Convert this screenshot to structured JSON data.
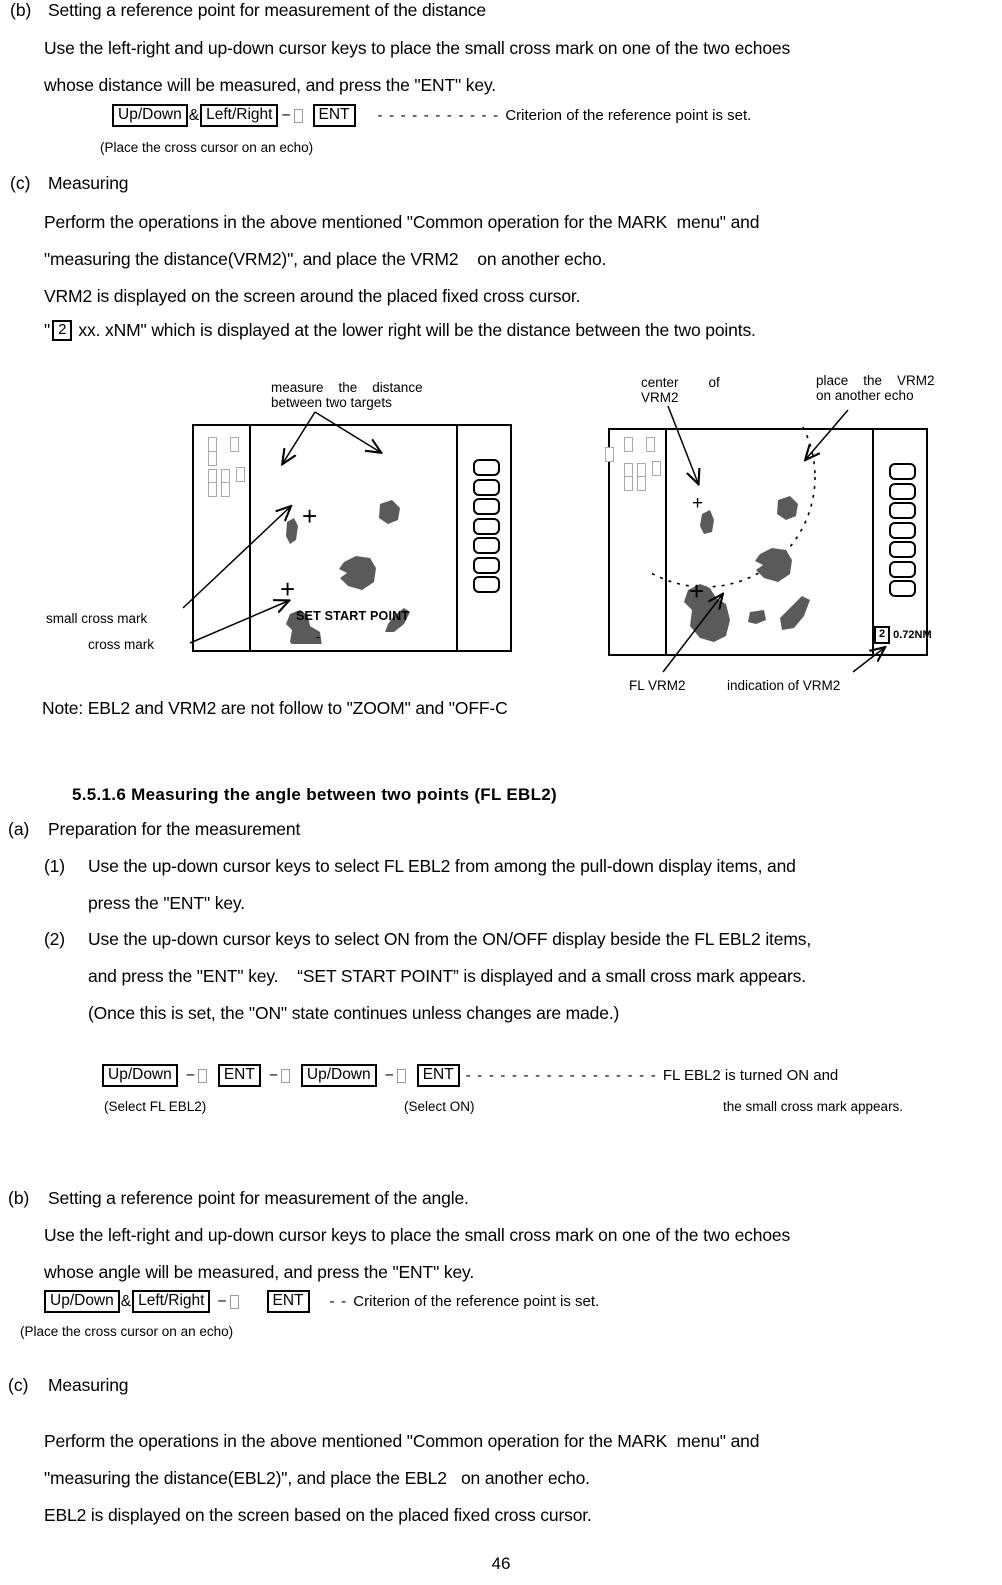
{
  "page": {
    "number": "46"
  },
  "section_b_distance": {
    "marker": "(b)",
    "title": "Setting a reference point for measurement of the distance",
    "line1": "Use the left-right and up-down cursor keys to place the small cross mark on one of the two echoes",
    "line2": "whose distance will be measured, and press the \"ENT\" key.",
    "keys": {
      "key1": "Up/Down",
      "amp": "&",
      "key2": "Left/Right",
      "minus": "−",
      "key3": "ENT",
      "dashes": "- - - - - - - - - - -",
      "result": "Criterion of the reference point is set."
    },
    "subnote": "(Place the cross cursor on an echo)"
  },
  "section_c_measuring": {
    "marker": "(c)",
    "title": "Measuring",
    "line1": "Perform the operations in the above mentioned \"Common operation for the MARK  menu\" and",
    "line2": "\"measuring the distance(VRM2)\", and place the VRM2    on another echo.",
    "line3": "VRM2 is displayed on the screen around the placed fixed cross cursor.",
    "line4_prefix": "\"",
    "line4_box": "2",
    "line4_suffix": "xx. xNM\" which is displayed at the lower right will be the distance between the two points."
  },
  "figure_left": {
    "callout_top": "measure    the    distance\nbetween two targets",
    "label_small_cross": "small cross mark",
    "label_cross": "cross mark",
    "screen_text": "SET START POINT",
    "softkey_count": 7
  },
  "figure_right": {
    "callout_center": "center        of\nVRM2",
    "callout_place": "place    the    VRM2\non another echo",
    "label_fl_vrm2": "FL VRM2",
    "label_indication": "indication of VRM2",
    "vrm_number": "2",
    "vrm_value": "0.72NM",
    "softkey_count": 7
  },
  "note": "Note: EBL2 and VRM2 are not follow to \"ZOOM\" and \"OFF-C",
  "heading_5516": "5.5.1.6 Measuring the angle between two points (FL EBL2)",
  "section_a_prep": {
    "marker": "(a)",
    "title": "Preparation for the measurement",
    "item1_marker": "(1)",
    "item1_line1": "Use the up-down cursor keys to select FL EBL2 from among the pull-down display items, and",
    "item1_line2": "press the \"ENT\" key.",
    "item2_marker": "(2)",
    "item2_line1": "Use the up-down cursor keys to select ON from the ON/OFF display beside the FL EBL2 items,",
    "item2_line2": "and press the \"ENT\" key.    “SET START POINT” is displayed and a small cross mark appears.",
    "item2_line3": "(Once this is set, the \"ON\" state continues unless changes are made.)"
  },
  "keyflow_eblon": {
    "key1": "Up/Down",
    "minus1": "−",
    "key2": "ENT",
    "minus2": "−",
    "key3": "Up/Down",
    "minus3": "−",
    "key4": "ENT",
    "dashes": "- - - - - - - - - - - - - - - - -",
    "result_line1": "FL EBL2 is turned ON and",
    "result_line2": "the small cross mark appears.",
    "sub1": "(Select FL EBL2)",
    "sub2": "(Select ON)"
  },
  "section_b_angle": {
    "marker": "(b)",
    "title": "Setting a reference point for measurement of the angle.",
    "line1": "Use the left-right and up-down cursor keys to place the small cross mark on one of the two echoes",
    "line2": "whose angle will be measured, and press the \"ENT\" key.",
    "keys": {
      "key1": "Up/Down",
      "amp": "&",
      "key2": "Left/Right",
      "minus": "−",
      "key3": "ENT",
      "dashes": "- -",
      "result": "Criterion of the reference point is set."
    },
    "subnote": "(Place the cross cursor on an echo)"
  },
  "section_c_measuring2": {
    "marker": "(c)",
    "title": "Measuring",
    "line1": "Perform the operations in the above mentioned \"Common operation for the MARK  menu\" and",
    "line2": "\"measuring the distance(EBL2)\", and place the EBL2   on another echo.",
    "line3": "EBL2 is displayed on the screen based on the placed fixed cross cursor."
  }
}
